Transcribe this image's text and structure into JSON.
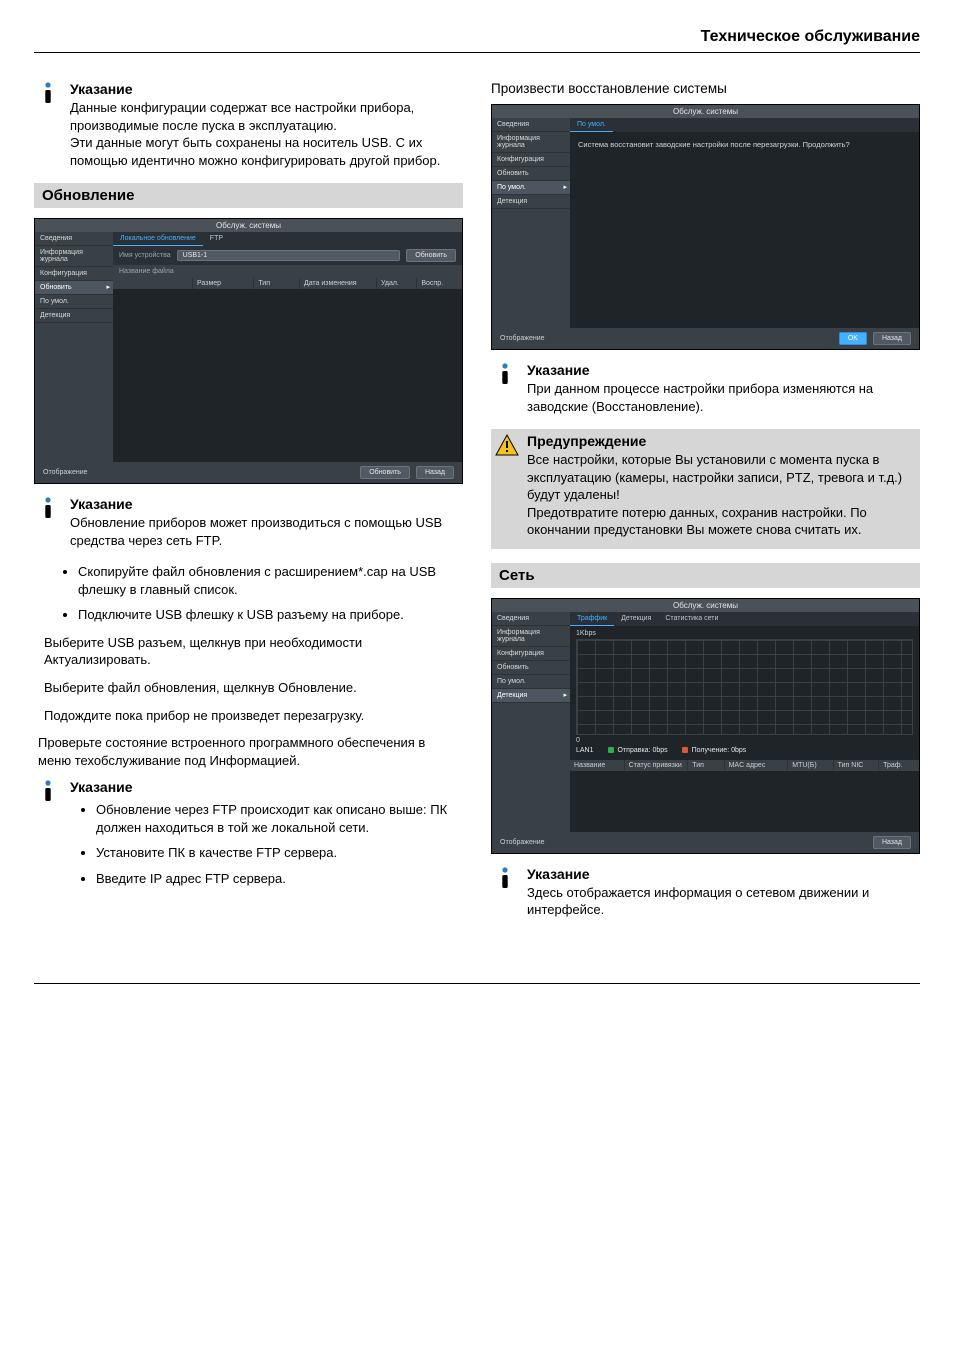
{
  "header": {
    "title": "Техническое обслуживание"
  },
  "left": {
    "note1": {
      "title": "Указание",
      "text": "Данные конфигурации содержат все настройки прибора, производимые после пуска в эксплуатацию.\nЭти данные могут быть сохранены на носитель USB. С их помощью идентично можно конфигурировать другой прибор."
    },
    "section_update": "Обновление",
    "ui_update": {
      "title": "Обслуж. системы",
      "sidebar": [
        "Сведения",
        "Информация журнала",
        "Конфигурация",
        "Обновить",
        "По умол.",
        "Детекция"
      ],
      "sidebar_selected": 3,
      "tabs": [
        "Локальное обновление",
        "FTP"
      ],
      "tab_selected": 0,
      "device_label": "Имя устройства",
      "device_value": "USB1-1",
      "refresh": "Обновить",
      "file_label": "Название файла",
      "cols": [
        "Размер",
        "Тип",
        "Дата изменения",
        "Удал.",
        "Воспр."
      ],
      "footer_left": "Отображение",
      "btn_update": "Обновить",
      "btn_back": "Назад"
    },
    "note2": {
      "title": "Указание",
      "text": "Обновление приборов может производиться с помощью USB средства через сеть FTP."
    },
    "bullets1": [
      "Скопируйте файл обновления с расширением*.cap на USB флешку в главный список.",
      "Подключите USB флешку к USB разъему на приборе."
    ],
    "steps": [
      "Выберите USB разъем, щелкнув при необходимости Актуализировать.",
      "Выберите файл обновления, щелкнув Обновление.",
      "Подождите пока прибор не произведет перезагрузку.",
      "Проверьте состояние встроенного программного обеспечения в меню техобслуживание под Информацией."
    ],
    "note3": {
      "title": "Указание"
    },
    "bullets2": [
      "Обновление через FTP происходит как описано выше: ПК должен находиться в той же локальной сети.",
      "Установите ПК в качестве FTP  сервера.",
      "Введите IP адрес FTP сервера."
    ]
  },
  "right": {
    "heading_restore": "Произвести восстановление системы",
    "ui_restore": {
      "title": "Обслуж. системы",
      "sidebar": [
        "Сведения",
        "Информация журнала",
        "Конфигурация",
        "Обновить",
        "По умол.",
        "Детекция"
      ],
      "sidebar_selected": 4,
      "tab": "По умол.",
      "message": "Система восстановит заводские настройки после перезагрузки. Продолжить?",
      "footer_left": "Отображение",
      "btn_ok": "OK",
      "btn_back": "Назад"
    },
    "note1": {
      "title": "Указание",
      "text": "При данном процессе настройки прибора изменяются на заводские (Восстановление)."
    },
    "warn": {
      "title": "Предупреждение",
      "text": "Все настройки, которые Вы установили с момента пуска в эксплуатацию (камеры, настройки записи, PTZ, тревога и т.д.) будут удалены!\nПредотвратите потерю данных, сохранив настройки. По окончании предустановки Вы можете снова считать их."
    },
    "section_net": "Сеть",
    "ui_net": {
      "title": "Обслуж. системы",
      "sidebar": [
        "Сведения",
        "Информация журнала",
        "Конфигурация",
        "Обновить",
        "По умол.",
        "Детекция"
      ],
      "sidebar_selected": 5,
      "tabs": [
        "Траффик",
        "Детекция",
        "Статистика сети"
      ],
      "tab_selected": 0,
      "ylabel": "1Kbps",
      "zero": "0",
      "lan": "LAN1",
      "send": "Отправка: 0bps",
      "recv": "Получение: 0bps",
      "cols": [
        "Название",
        "Статус привязки",
        "Тип",
        "MAC адрес",
        "MTU(Б)",
        "Тип NIC",
        "Траф."
      ],
      "footer_left": "Отображение",
      "btn_back": "Назад"
    },
    "note2": {
      "title": "Указание",
      "text": "Здесь отображается информация о сетевом движении и интерфейсе."
    }
  },
  "chart_data": {
    "type": "line",
    "title": "",
    "ylabel": "1Kbps",
    "ylim": [
      0,
      1
    ],
    "series": [
      {
        "name": "Отправка: 0bps",
        "values": []
      },
      {
        "name": "Получение: 0bps",
        "values": []
      }
    ],
    "x": [],
    "note": "Graph area is empty (0 traffic) in the screenshot"
  }
}
